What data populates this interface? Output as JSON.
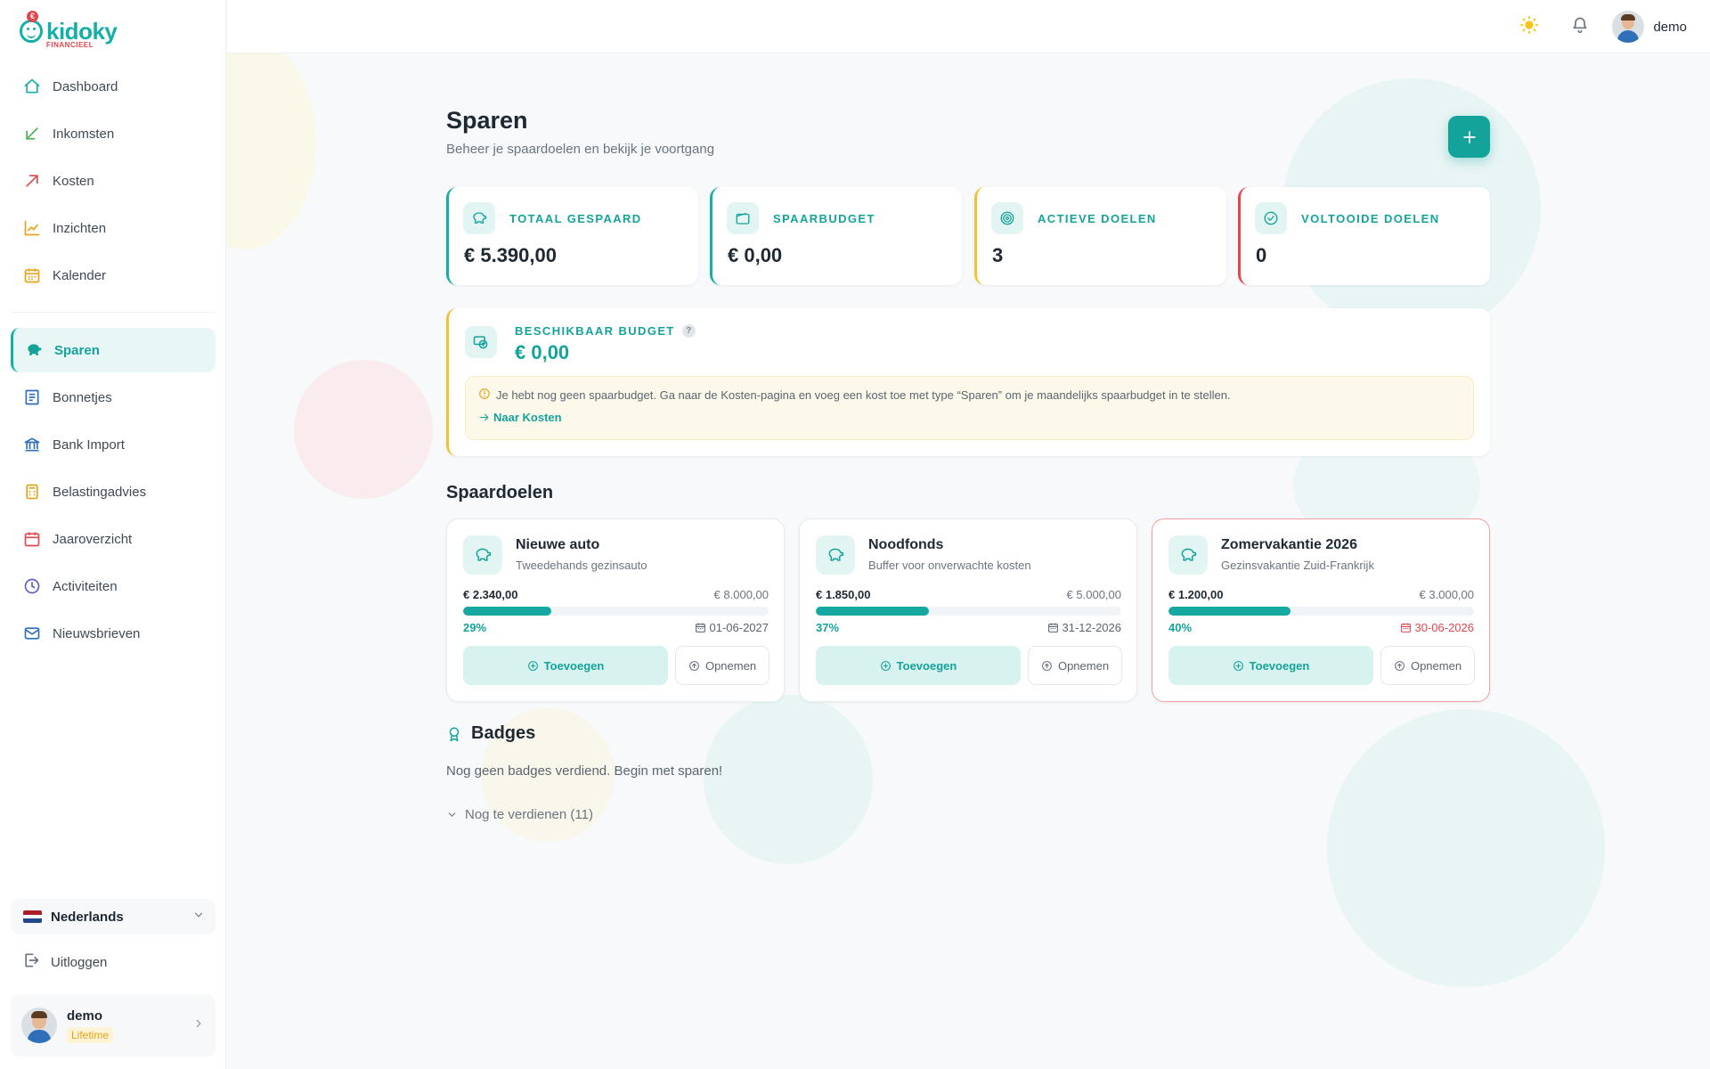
{
  "brand": {
    "name": "kidoky",
    "sub": "FINANCIEEL",
    "euro": "€"
  },
  "sidebar": {
    "items": [
      {
        "label": "Dashboard",
        "icon": "home-icon"
      },
      {
        "label": "Inkomsten",
        "icon": "arrow-down-left-icon"
      },
      {
        "label": "Kosten",
        "icon": "arrow-up-right-icon"
      },
      {
        "label": "Inzichten",
        "icon": "line-chart-icon"
      },
      {
        "label": "Kalender",
        "icon": "calendar-icon"
      },
      {
        "label": "Sparen",
        "icon": "piggy-bank-icon",
        "active": true
      },
      {
        "label": "Bonnetjes",
        "icon": "receipt-icon"
      },
      {
        "label": "Bank Import",
        "icon": "bank-icon"
      },
      {
        "label": "Belastingadvies",
        "icon": "calculator-icon"
      },
      {
        "label": "Jaaroverzicht",
        "icon": "calendar-range-icon"
      },
      {
        "label": "Activiteiten",
        "icon": "clock-icon"
      },
      {
        "label": "Nieuwsbrieven",
        "icon": "mail-icon"
      }
    ],
    "language": "Nederlands",
    "logout": "Uitloggen",
    "user": {
      "name": "demo",
      "plan": "Lifetime"
    }
  },
  "topbar": {
    "username": "demo"
  },
  "page": {
    "title": "Sparen",
    "subtitle": "Beheer je spaardoelen en bekijk je voortgang"
  },
  "stats": [
    {
      "label": "TOTAAL GESPAARD",
      "value": "€ 5.390,00",
      "color": "#14b0a8"
    },
    {
      "label": "SPAARBUDGET",
      "value": "€ 0,00",
      "color": "#14b0a8"
    },
    {
      "label": "ACTIEVE DOELEN",
      "value": "3",
      "color": "#f2c230"
    },
    {
      "label": "VOLTOOIDE DOELEN",
      "value": "0",
      "color": "#e2474c"
    }
  ],
  "budget": {
    "label": "BESCHIKBAAR BUDGET",
    "help": "?",
    "value": "€ 0,00",
    "notice": "Je hebt nog geen spaarbudget. Ga naar de Kosten-pagina en voeg een kost toe met type “Sparen” om je maandelijks spaarbudget in te stellen.",
    "link": "Naar Kosten"
  },
  "goals_title": "Spaardoelen",
  "goals": [
    {
      "name": "Nieuwe auto",
      "desc": "Tweedehands gezinsauto",
      "current": "€ 2.340,00",
      "target": "€ 8.000,00",
      "progress": 0.29,
      "pct": "29%",
      "date": "01-06-2027",
      "add": "Toevoegen",
      "withdraw": "Opnemen",
      "overdue": false
    },
    {
      "name": "Noodfonds",
      "desc": "Buffer voor onverwachte kosten",
      "current": "€ 1.850,00",
      "target": "€ 5.000,00",
      "progress": 0.37,
      "pct": "37%",
      "date": "31-12-2026",
      "add": "Toevoegen",
      "withdraw": "Opnemen",
      "overdue": false
    },
    {
      "name": "Zomervakantie 2026",
      "desc": "Gezinsvakantie Zuid-Frankrijk",
      "current": "€ 1.200,00",
      "target": "€ 3.000,00",
      "progress": 0.4,
      "pct": "40%",
      "date": "30-06-2026",
      "add": "Toevoegen",
      "withdraw": "Opnemen",
      "overdue": true
    }
  ],
  "badges": {
    "title": "Badges",
    "empty": "Nog geen badges verdiend. Begin met sparen!",
    "more": "Nog te verdienen (11)"
  },
  "colors": {
    "accent": "#14a39b",
    "warning": "#f2c230",
    "danger": "#e2474c"
  }
}
